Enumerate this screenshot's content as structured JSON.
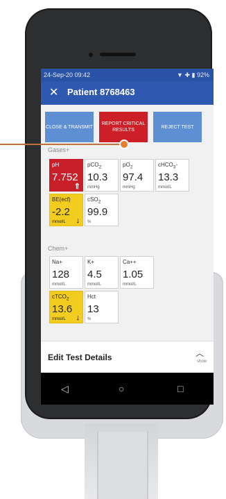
{
  "status_bar": {
    "time": "24-Sep-20 09:42",
    "battery": "92%"
  },
  "header": {
    "close_icon": "close-icon",
    "title": "Patient 8768463"
  },
  "actions": {
    "close_transmit": "CLOSE & TRANSMIT",
    "report_critical": "REPORT CRITICAL RESULTS",
    "reject_test": "REJECT TEST"
  },
  "gases": {
    "label": "Gases+",
    "tiles": [
      {
        "label": "pH",
        "value": "7.752",
        "unit": "",
        "status": "critical-high"
      },
      {
        "label": "pCO2",
        "value": "10.3",
        "unit": "mmHg",
        "status": "normal"
      },
      {
        "label": "pO2",
        "value": "97.4",
        "unit": "mmHg",
        "status": "normal"
      },
      {
        "label": "cHCO3-",
        "value": "13.3",
        "unit": "mmol/L",
        "status": "normal"
      },
      {
        "label": "BE(ecf)",
        "value": "-2.2",
        "unit": "mmol/L",
        "status": "low"
      },
      {
        "label": "cSO2",
        "value": "99.9",
        "unit": "%",
        "status": "normal"
      }
    ]
  },
  "chem": {
    "label": "Chem+",
    "tiles": [
      {
        "label": "Na+",
        "value": "128",
        "unit": "mmol/L",
        "status": "normal"
      },
      {
        "label": "K+",
        "value": "4.5",
        "unit": "mmol/L",
        "status": "normal"
      },
      {
        "label": "Ca++",
        "value": "1.05",
        "unit": "mmol/L",
        "status": "normal"
      },
      {
        "label": "cTCO2",
        "value": "13.6",
        "unit": "mmol/L",
        "status": "low"
      },
      {
        "label": "Hct",
        "value": "13",
        "unit": "%",
        "status": "normal"
      }
    ]
  },
  "bottom": {
    "title": "Edit Test Details",
    "show_label": "show"
  },
  "nav": {
    "back": "◁",
    "home": "○",
    "recent": "□"
  },
  "colors": {
    "primary": "#2f58b0",
    "critical": "#cd1f27",
    "warning": "#f2cc1f",
    "button": "#5f8fd3"
  }
}
